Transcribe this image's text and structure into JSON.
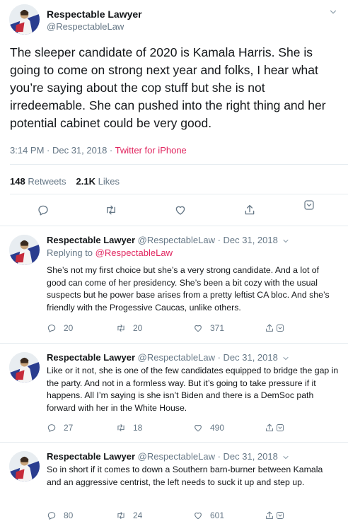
{
  "main_tweet": {
    "name": "Respectable Lawyer",
    "handle": "@RespectableLaw",
    "text": "The sleeper candidate of 2020 is Kamala Harris. She is going to come on strong next year and folks, I hear what you’re saying about the cop stuff but she is not irredeemable. She can pushed into the right thing and her potential cabinet could be very good.",
    "time_date": "3:14 PM · Dec 31, 2018 · ",
    "source": "Twitter for iPhone",
    "retweets_count": "148",
    "retweets_label": "Retweets",
    "likes_count": "2.1K",
    "likes_label": "Likes",
    "icons": [
      "reply-icon",
      "retweet-icon",
      "like-icon",
      "share-icon",
      "chevron-down-icon"
    ]
  },
  "replies": [
    {
      "name": "Respectable Lawyer",
      "meta": "@RespectableLaw · Dec 31, 2018",
      "replying_prefix": "Replying to ",
      "replying_to": "@RespectableLaw",
      "text": "She’s not my first choice but she’s a very strong candidate. And a lot of good can come of her presidency. She’s been a bit cozy with the usual suspects but he power base arises from a pretty leftist CA bloc. And she’s friendly with the Progessive Caucas, unlike others.",
      "replies": "20",
      "retweets": "20",
      "likes": "371"
    },
    {
      "name": "Respectable Lawyer",
      "meta": "@RespectableLaw · Dec 31, 2018",
      "text": "Like or it not, she is one of the few candidates equipped to bridge the gap in the party. And not in a formless way. But it’s going to take pressure if it happens. All I’m saying is she isn’t Biden and there is a DemSoc path forward with her in the White House.",
      "replies": "27",
      "retweets": "18",
      "likes": "490"
    },
    {
      "name": "Respectable Lawyer",
      "meta": "@RespectableLaw · Dec 31, 2018",
      "text": "So in short if it comes to down a Southern barn-burner between Kamala and an aggressive centrist, the left needs to suck it up and step up.",
      "replies": "80",
      "retweets": "24",
      "likes": "601"
    }
  ],
  "colors": {
    "text": "#14171a",
    "secondary": "#657786",
    "link": "#e0245e",
    "divider": "#e6ecf0"
  }
}
